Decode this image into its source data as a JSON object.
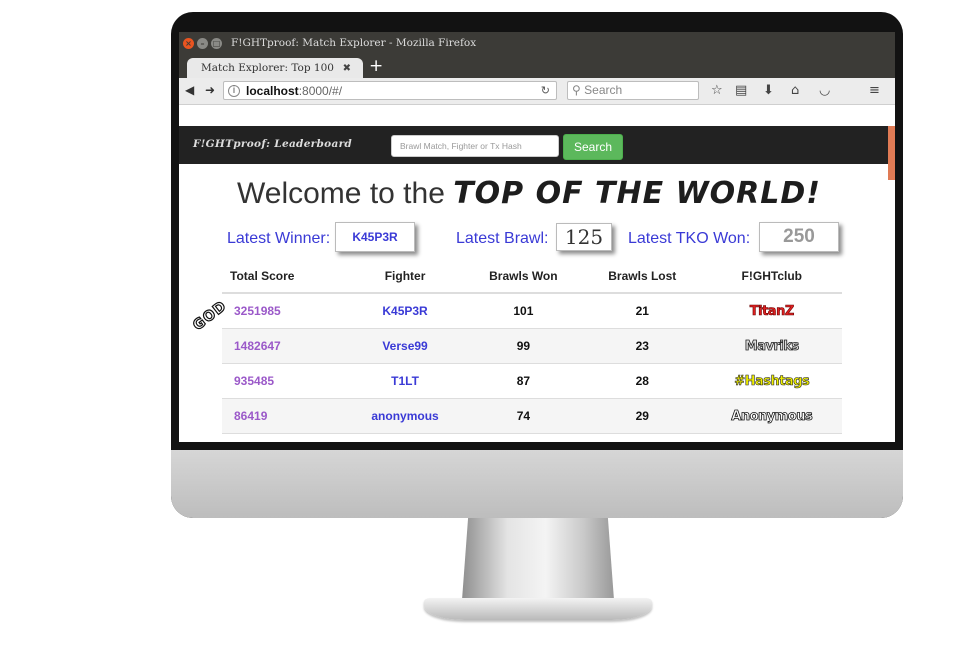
{
  "browser": {
    "window_title": "F!GHTproof:  Match Explorer - Mozilla Firefox",
    "tab_title": "Match Explorer: Top 100",
    "url_host": "localhost",
    "url_rest": ":8000/#/",
    "search_placeholder": "Search"
  },
  "app": {
    "brand": "F!GHTproof: Leaderboard",
    "search_placeholder": "Brawl Match, Fighter or Tx Hash",
    "search_button": "Search"
  },
  "headline": {
    "prefix": "Welcome to the ",
    "emphasis": "TOP OF THE WORLD!"
  },
  "stats": {
    "latest_winner_label": "Latest Winner:",
    "latest_winner_value": "K45P3R",
    "latest_brawl_label": "Latest Brawl:",
    "latest_brawl_value": "125",
    "latest_tko_label": "Latest TKO Won:",
    "latest_tko_value": "250"
  },
  "badge": "GOD",
  "table": {
    "headers": [
      "Total Score",
      "Fighter",
      "Brawls Won",
      "Brawls Lost",
      "F!GHTclub"
    ],
    "rows": [
      {
        "score": "3251985",
        "fighter": "K45P3R",
        "won": "101",
        "lost": "21",
        "club": "TitanZ"
      },
      {
        "score": "1482647",
        "fighter": "Verse99",
        "won": "99",
        "lost": "23",
        "club": "Mavriks"
      },
      {
        "score": "935485",
        "fighter": "T1LT",
        "won": "87",
        "lost": "28",
        "club": "#Hashtags"
      },
      {
        "score": "86419",
        "fighter": "anonymous",
        "won": "74",
        "lost": "29",
        "club": "Anonymous"
      }
    ]
  }
}
